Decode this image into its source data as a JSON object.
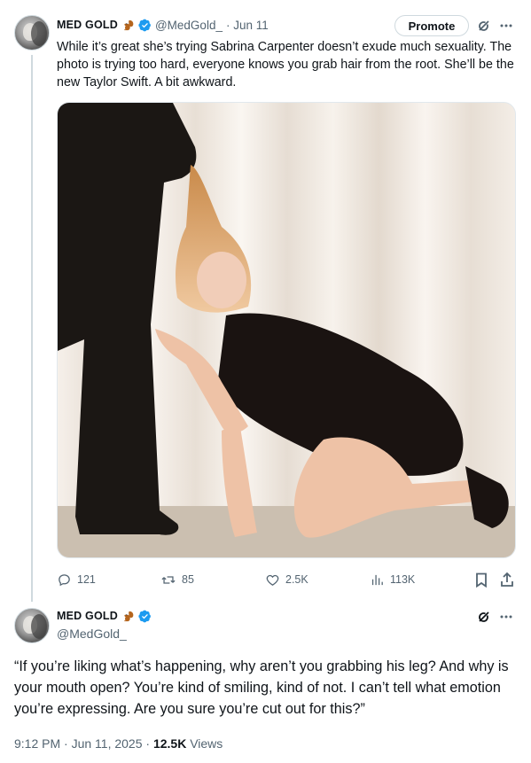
{
  "tweet1": {
    "author_name": "MED GOLD",
    "handle": "@MedGold_",
    "date": "· Jun 11",
    "promote_label": "Promote",
    "text": "While it’s great she’s trying Sabrina Carpenter doesn’t exude much sexuality. The photo is trying too hard, everyone knows you grab hair from the root. She’ll be the new Taylor Swift. A bit awkward.",
    "image_icon": "photo-icon",
    "stats": {
      "replies": "121",
      "reposts": "85",
      "likes": "2.5K",
      "views": "113K"
    }
  },
  "tweet2": {
    "author_name": "MED GOLD",
    "handle": "@MedGold_",
    "text": "“If you’re liking what’s happening, why aren’t you grabbing his leg? And why is your mouth open? You’re kind of smiling, kind of not. I can’t tell what emotion you’re expressing. Are you sure you’re cut out for this?”",
    "time": "9:12 PM · Jun 11, 2025 · ",
    "views_count": "12.5K",
    "views_label": " Views"
  },
  "colors": {
    "verified": "#1d9bf0",
    "muted": "#536471",
    "border": "#cfd9de"
  }
}
